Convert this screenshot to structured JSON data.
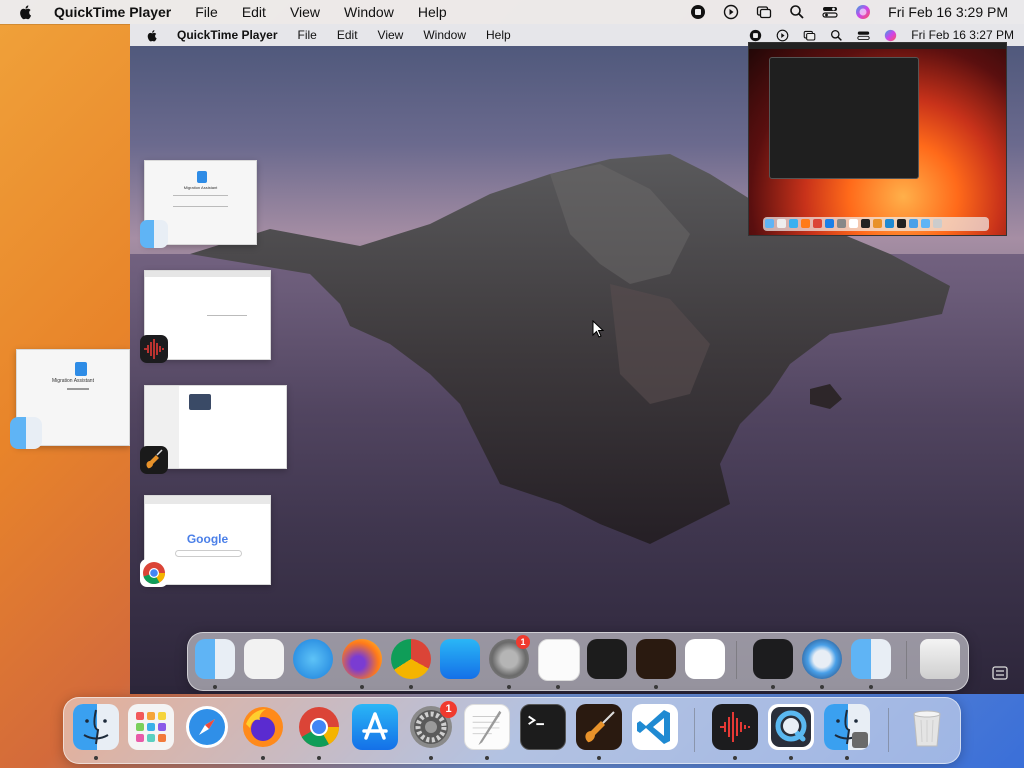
{
  "outer_menubar": {
    "app_name": "QuickTime Player",
    "menus": [
      "File",
      "Edit",
      "View",
      "Window",
      "Help"
    ],
    "clock": "Fri Feb 16  3:29 PM"
  },
  "inner_menubar": {
    "app_name": "QuickTime Player",
    "menus": [
      "File",
      "Edit",
      "View",
      "Window",
      "Help"
    ],
    "clock": "Fri Feb 16  3:27 PM"
  },
  "thumbnails": {
    "migration_title": "Migration Assistant",
    "google_logo": "Google"
  },
  "dock": {
    "system_settings_badge": "1"
  },
  "colors": {
    "badge": "#f03a2e",
    "vscode_blue": "#1f8ad2",
    "finder_blue": "#2e8ce6"
  }
}
